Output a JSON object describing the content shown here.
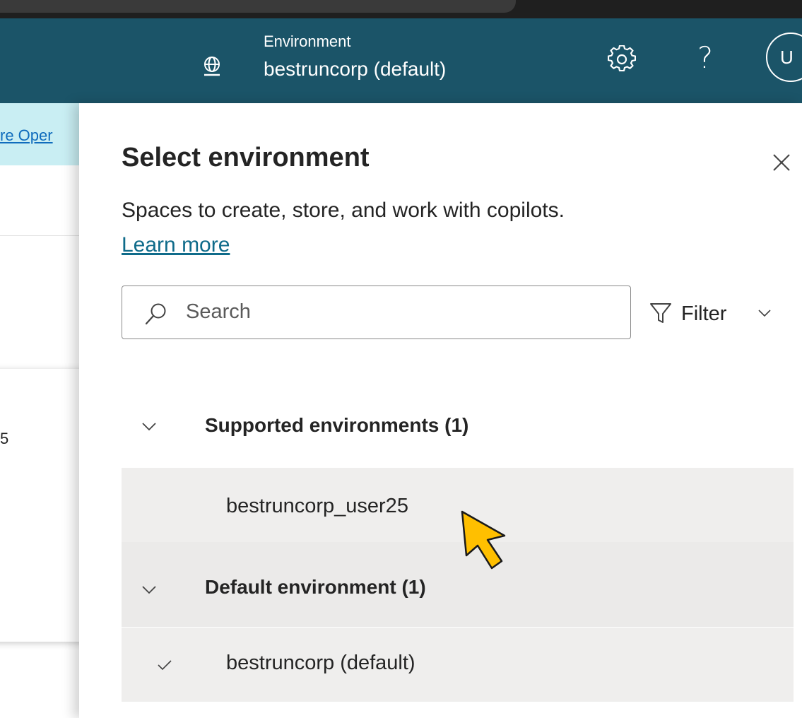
{
  "header": {
    "environment_label": "Environment",
    "environment_value": "bestruncorp (default)",
    "help_label": "?",
    "avatar_initial": "U"
  },
  "background": {
    "banner_link": "re Oper",
    "card_text": "5"
  },
  "panel": {
    "title": "Select environment",
    "description": "Spaces to create, store, and work with copilots.",
    "learn_more": "Learn more",
    "search": {
      "placeholder": "Search",
      "value": ""
    },
    "filter_label": "Filter",
    "groups": [
      {
        "label": "Supported environments (1)",
        "items": [
          {
            "label": "bestruncorp_user25",
            "selected": false
          }
        ]
      },
      {
        "label": "Default environment (1)",
        "items": [
          {
            "label": "bestruncorp (default)",
            "selected": true
          }
        ]
      }
    ]
  },
  "colors": {
    "header_bg": "#1b5468",
    "banner_bg": "#c9eef3",
    "row_bg": "#efeeed",
    "link": "#0f6b8a",
    "cursor_fill": "#ffbf00"
  },
  "icons": [
    "globe-icon",
    "gear-icon",
    "close-icon",
    "search-icon",
    "filter-icon",
    "chevron-down-icon",
    "checkmark-icon",
    "mouse-cursor-icon"
  ]
}
